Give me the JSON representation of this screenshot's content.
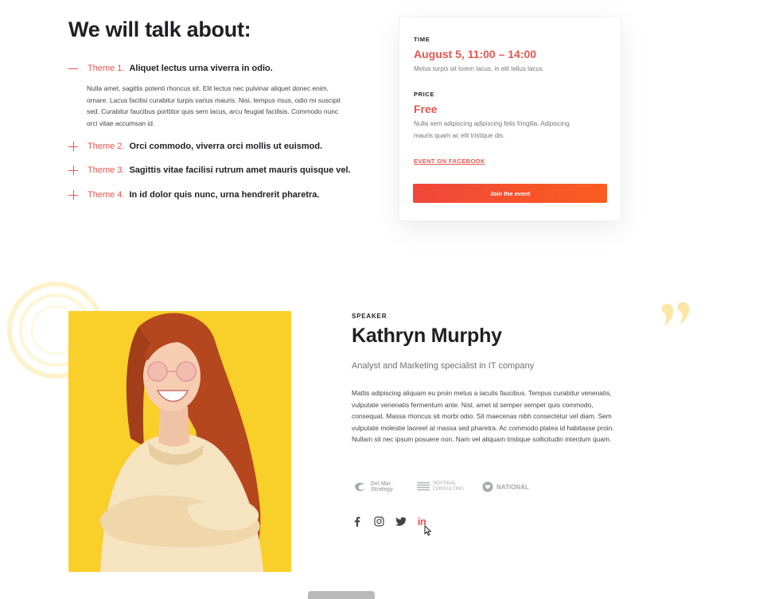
{
  "talk": {
    "heading": "We will talk about:",
    "themes": [
      {
        "label": "Theme 1.",
        "title": "Aliquet lectus urna viverra in odio.",
        "expanded": true,
        "body": "Nulla amet, sagittis potenti rhoncus sit. Elit lectus nec pulvinar aliquet donec enim, ornare. Lacus facilisi curabitur turpis varius mauris. Nisi, tempus risus, odio mi suscipit sed. Curabitur faucibus porttitor quis sem lacus, arcu feugiat facilisis. Commodo nunc orci vitae accumsan id."
      },
      {
        "label": "Theme 2.",
        "title": "Orci commodo, viverra orci mollis ut euismod.",
        "expanded": false
      },
      {
        "label": "Theme 3.",
        "title": "Sagittis vitae facilisi rutrum amet mauris quisque vel.",
        "expanded": false
      },
      {
        "label": "Theme 4.",
        "title": "In id dolor quis nunc, urna hendrerit pharetra.",
        "expanded": false
      }
    ]
  },
  "event": {
    "time_label": "TIME",
    "time_value": "August 5, 11:00 – 14:00",
    "time_desc": "Metus turpis sit lorem lacus, in elit tellus lacus.",
    "price_label": "PRICE",
    "price_value": "Free",
    "price_desc": "Nulla sem adipiscing adipiscing felis fringilla. Adipiscing mauris quam ac elit tristique dis.",
    "facebook_link": "EVENT ON FACEBOOK",
    "join_button": "Join the event"
  },
  "speaker": {
    "label": "SPEAKER",
    "name": "Kathryn Murphy",
    "role": "Analyst and Marketing specialist in IT company",
    "bio": "Mattis adipiscing aliquam eu proin metus a iaculis faucibus. Tempus curabitur venenatis, vulputate venenatis fermentum ante. Nisl, amet id semper semper quis commodo, consequat. Massa rhoncus sit morbi odio. Sit maecenas nibh consectetur vel diam. Sem vulputate molestie laoreet at massa sed pharetra. Ac commodo platea id habitasse proin. Nullam sit nec ipsum posuere non. Nam vel aliquam tristique sollicitudin interdum quam.",
    "partners": [
      {
        "line1": "Del Mar",
        "line2": "Strategy"
      },
      {
        "line1": "SENTINAL",
        "line2": "CONSULTING"
      },
      {
        "line1": "NATIONAL"
      }
    ],
    "socials": [
      "facebook-icon",
      "instagram-icon",
      "twitter-icon",
      "linkedin-icon"
    ],
    "linkedin_text": "in"
  },
  "colors": {
    "accent": "#e8554e",
    "photo_bg": "#f9cf2a",
    "button_from": "#f0473a",
    "button_to": "#fb5c1f"
  }
}
